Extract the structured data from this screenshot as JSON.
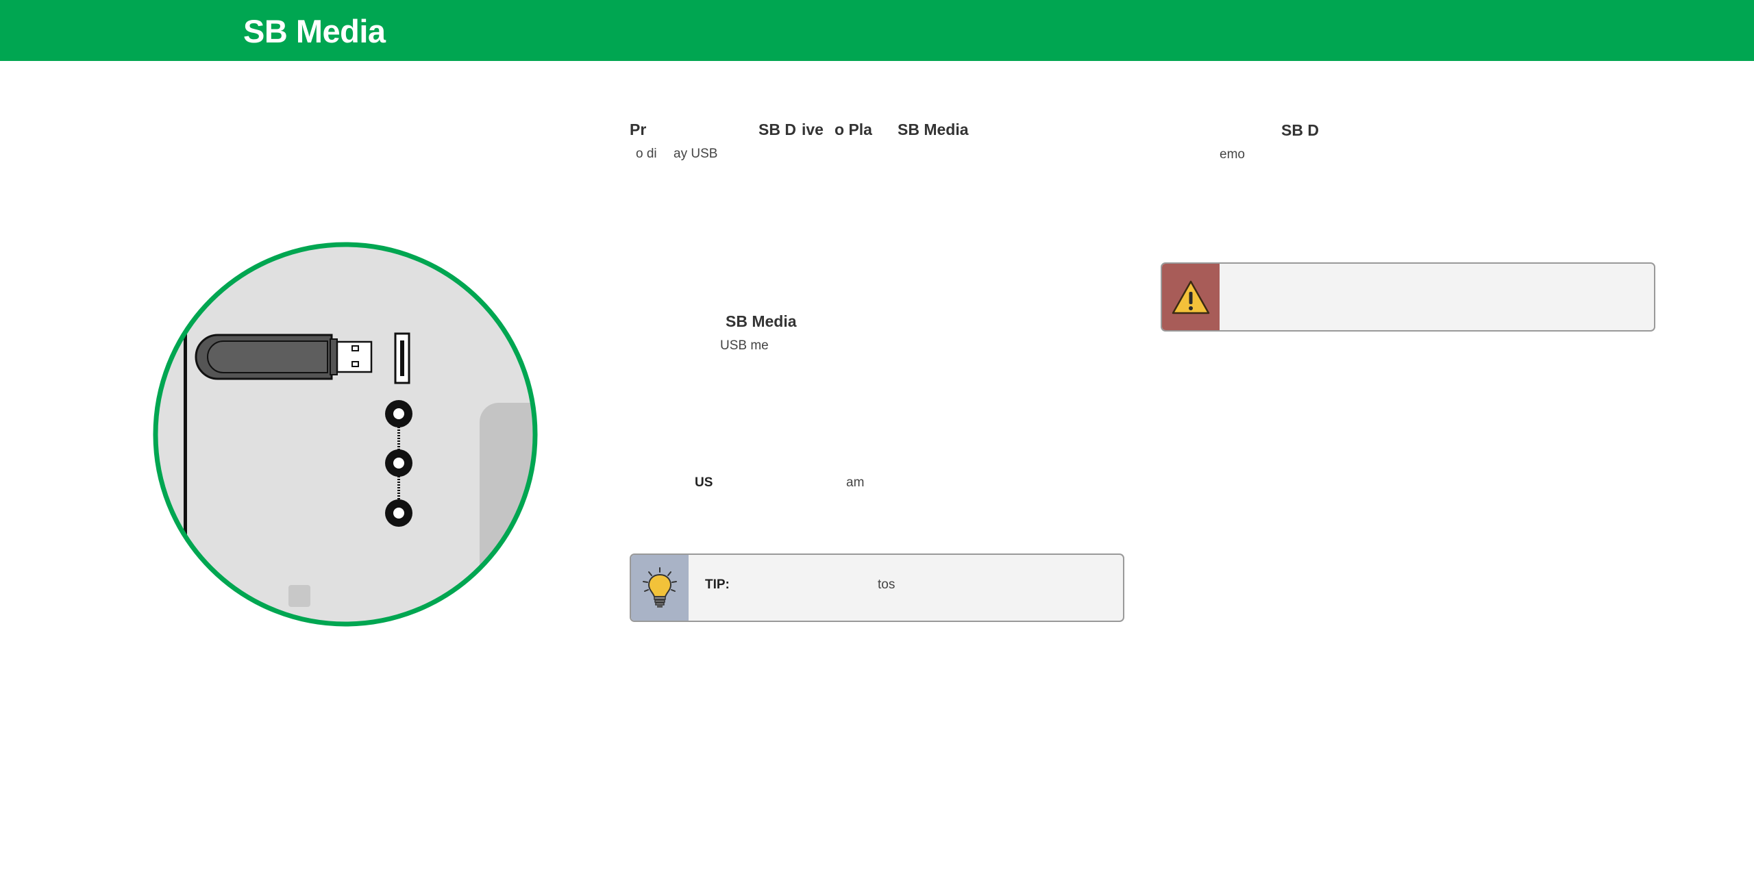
{
  "header": {
    "title": "SB Media"
  },
  "content": {
    "col1_heading_a": "Pr",
    "col1_heading_b": "SB D",
    "col1_heading_c": "ive",
    "col1_heading_d": "o Pla",
    "col1_heading_e": "SB Media",
    "col1_sub_a": "o di",
    "col1_sub_b": "ay USB",
    "col2_heading": "SB D",
    "col2_sub": "emo",
    "section2_heading": "SB Media",
    "section2_sub": "USB me",
    "section3_bold": "US",
    "section3_text": "am"
  },
  "tip": {
    "label": "TIP:",
    "text": "tos"
  },
  "icons": {
    "warning": "warning-icon",
    "tip": "lightbulb-icon",
    "illustration": "usb-port-illustration"
  },
  "colors": {
    "brand": "#00a651",
    "warning_bg": "#a85c58",
    "tip_bg": "#a9b3c6"
  }
}
